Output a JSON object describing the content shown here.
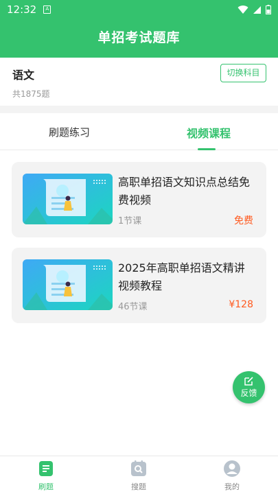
{
  "status_bar": {
    "time": "12:32",
    "sim_label": "A"
  },
  "header": {
    "title": "单招考试题库"
  },
  "subject": {
    "name": "语文",
    "count": "共1875题",
    "switch_label": "切换科目"
  },
  "tabs": [
    {
      "label": "刷题练习",
      "active": false
    },
    {
      "label": "视频课程",
      "active": true
    }
  ],
  "courses": [
    {
      "title": "高职单招语文知识点总结免费视频",
      "lessons": "1节课",
      "price": "免费"
    },
    {
      "title": "2025年高职单招语文精讲视频教程",
      "lessons": "46节课",
      "price": "¥128"
    }
  ],
  "feedback": {
    "label": "反馈"
  },
  "bottom_nav": [
    {
      "label": "刷题",
      "active": true,
      "icon": "document-icon"
    },
    {
      "label": "搜题",
      "active": false,
      "icon": "search-icon"
    },
    {
      "label": "我的",
      "active": false,
      "icon": "user-icon"
    }
  ],
  "colors": {
    "primary": "#34c26e",
    "price": "#ff5a1f",
    "card_bg": "#f3f3f3"
  }
}
